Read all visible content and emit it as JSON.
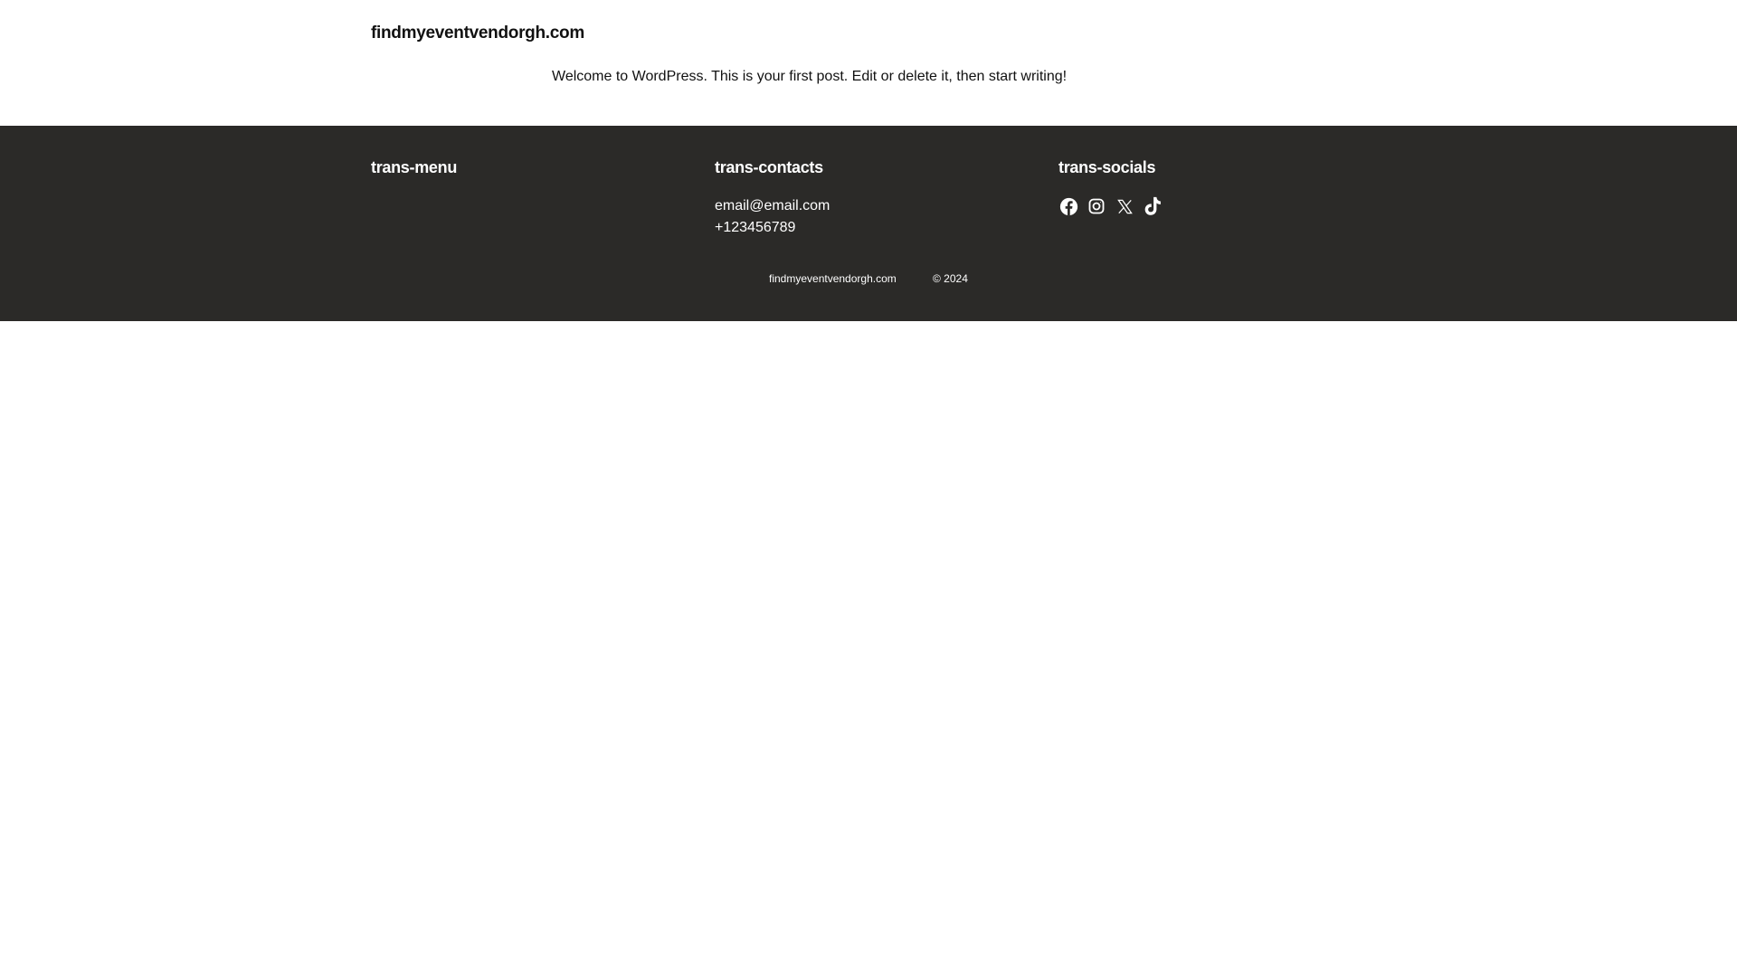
{
  "header": {
    "site_title": "findmyeventvendorgh.com",
    "post_excerpt": "Welcome to WordPress. This is your first post. Edit or delete it, then start writing!"
  },
  "footer": {
    "menu": {
      "title": "trans-menu"
    },
    "contacts": {
      "title": "trans-contacts",
      "email": "email@email.com",
      "phone": "+123456789"
    },
    "socials": {
      "title": "trans-socials",
      "icons": [
        "facebook-icon",
        "instagram-icon",
        "x-icon",
        "tiktok-icon"
      ]
    },
    "copyright": {
      "site": "findmyeventvendorgh.com",
      "year": "© 2024"
    }
  },
  "colors": {
    "page_background": "#ffffff",
    "footer_background": "#2b2a28",
    "footer_text": "#ffffff",
    "body_text": "#111111"
  }
}
